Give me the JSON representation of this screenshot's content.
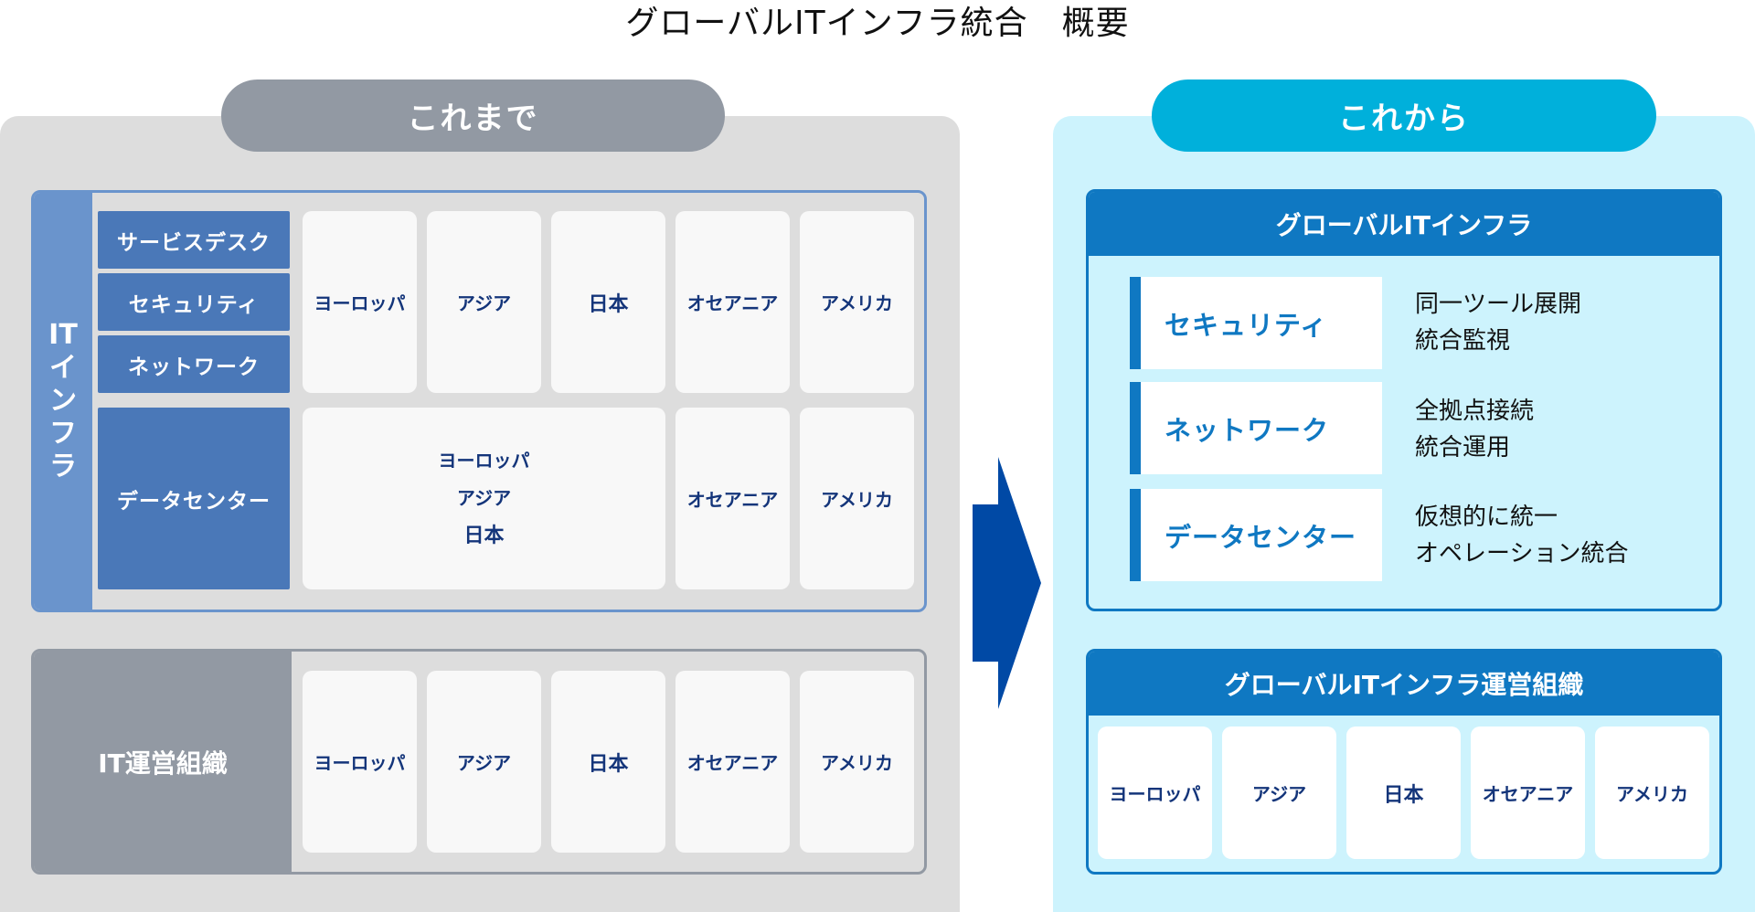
{
  "title": "グローバルITインフラ統合　概要",
  "before": {
    "label": "これまで",
    "infra": {
      "label_lines": [
        "IT",
        "イ",
        "ン",
        "フ",
        "ラ"
      ],
      "categories": [
        "サービスデスク",
        "セキュリティ",
        "ネットワーク",
        "データセンター"
      ],
      "regions": [
        "ヨーロッパ",
        "アジア",
        "日本",
        "オセアニア",
        "アメリカ"
      ],
      "datacenter_merged": [
        "ヨーロッパ",
        "アジア",
        "日本"
      ],
      "datacenter_separate": [
        "オセアニア",
        "アメリカ"
      ]
    },
    "org": {
      "label": "IT運営組織",
      "regions": [
        "ヨーロッパ",
        "アジア",
        "日本",
        "オセアニア",
        "アメリカ"
      ]
    }
  },
  "after": {
    "label": "これから",
    "infra": {
      "header": "グローバルITインフラ",
      "items": [
        {
          "name": "セキュリティ",
          "desc": [
            "同一ツール展開",
            "統合監視"
          ]
        },
        {
          "name": "ネットワーク",
          "desc": [
            "全拠点接続",
            "統合運用"
          ]
        },
        {
          "name": "データセンター",
          "desc": [
            "仮想的に統一",
            "オペレーション統合"
          ]
        }
      ]
    },
    "org": {
      "header": "グローバルITインフラ運営組織",
      "regions": [
        "ヨーロッパ",
        "アジア",
        "日本",
        "オセアニア",
        "アメリカ"
      ]
    }
  },
  "colors": {
    "before_accent": "#9299a3",
    "infra_blue": "#6a94cc",
    "category_blue": "#4a78b8",
    "after_accent": "#00b0db",
    "after_blue": "#0f78c2",
    "arrow": "#0049a5",
    "region_text": "#14357a"
  }
}
